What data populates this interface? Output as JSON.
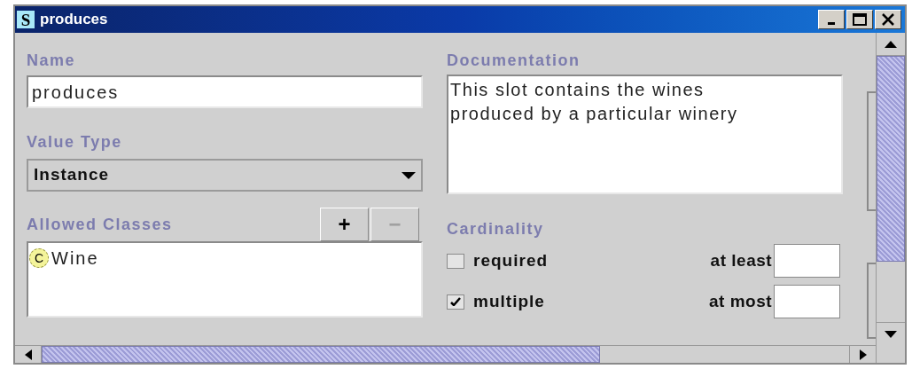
{
  "window": {
    "title": "produces",
    "icon_letter": "S"
  },
  "name": {
    "label": "Name",
    "value": "produces"
  },
  "value_type": {
    "label": "Value Type",
    "value": "Instance"
  },
  "allowed_classes": {
    "label": "Allowed Classes",
    "buttons": [
      {
        "label": "+",
        "disabled": false
      },
      {
        "label": "−",
        "disabled": true
      }
    ],
    "items": [
      {
        "badge": "C",
        "name": "Wine"
      }
    ]
  },
  "documentation": {
    "label": "Documentation",
    "value": "This slot contains the wines produced by a particular winery"
  },
  "cardinality": {
    "label": "Cardinality",
    "options": [
      {
        "label": "required",
        "checked": false
      },
      {
        "label": "multiple",
        "checked": true
      }
    ],
    "bounds": [
      {
        "label": "at least"
      },
      {
        "label": "at most"
      }
    ]
  }
}
